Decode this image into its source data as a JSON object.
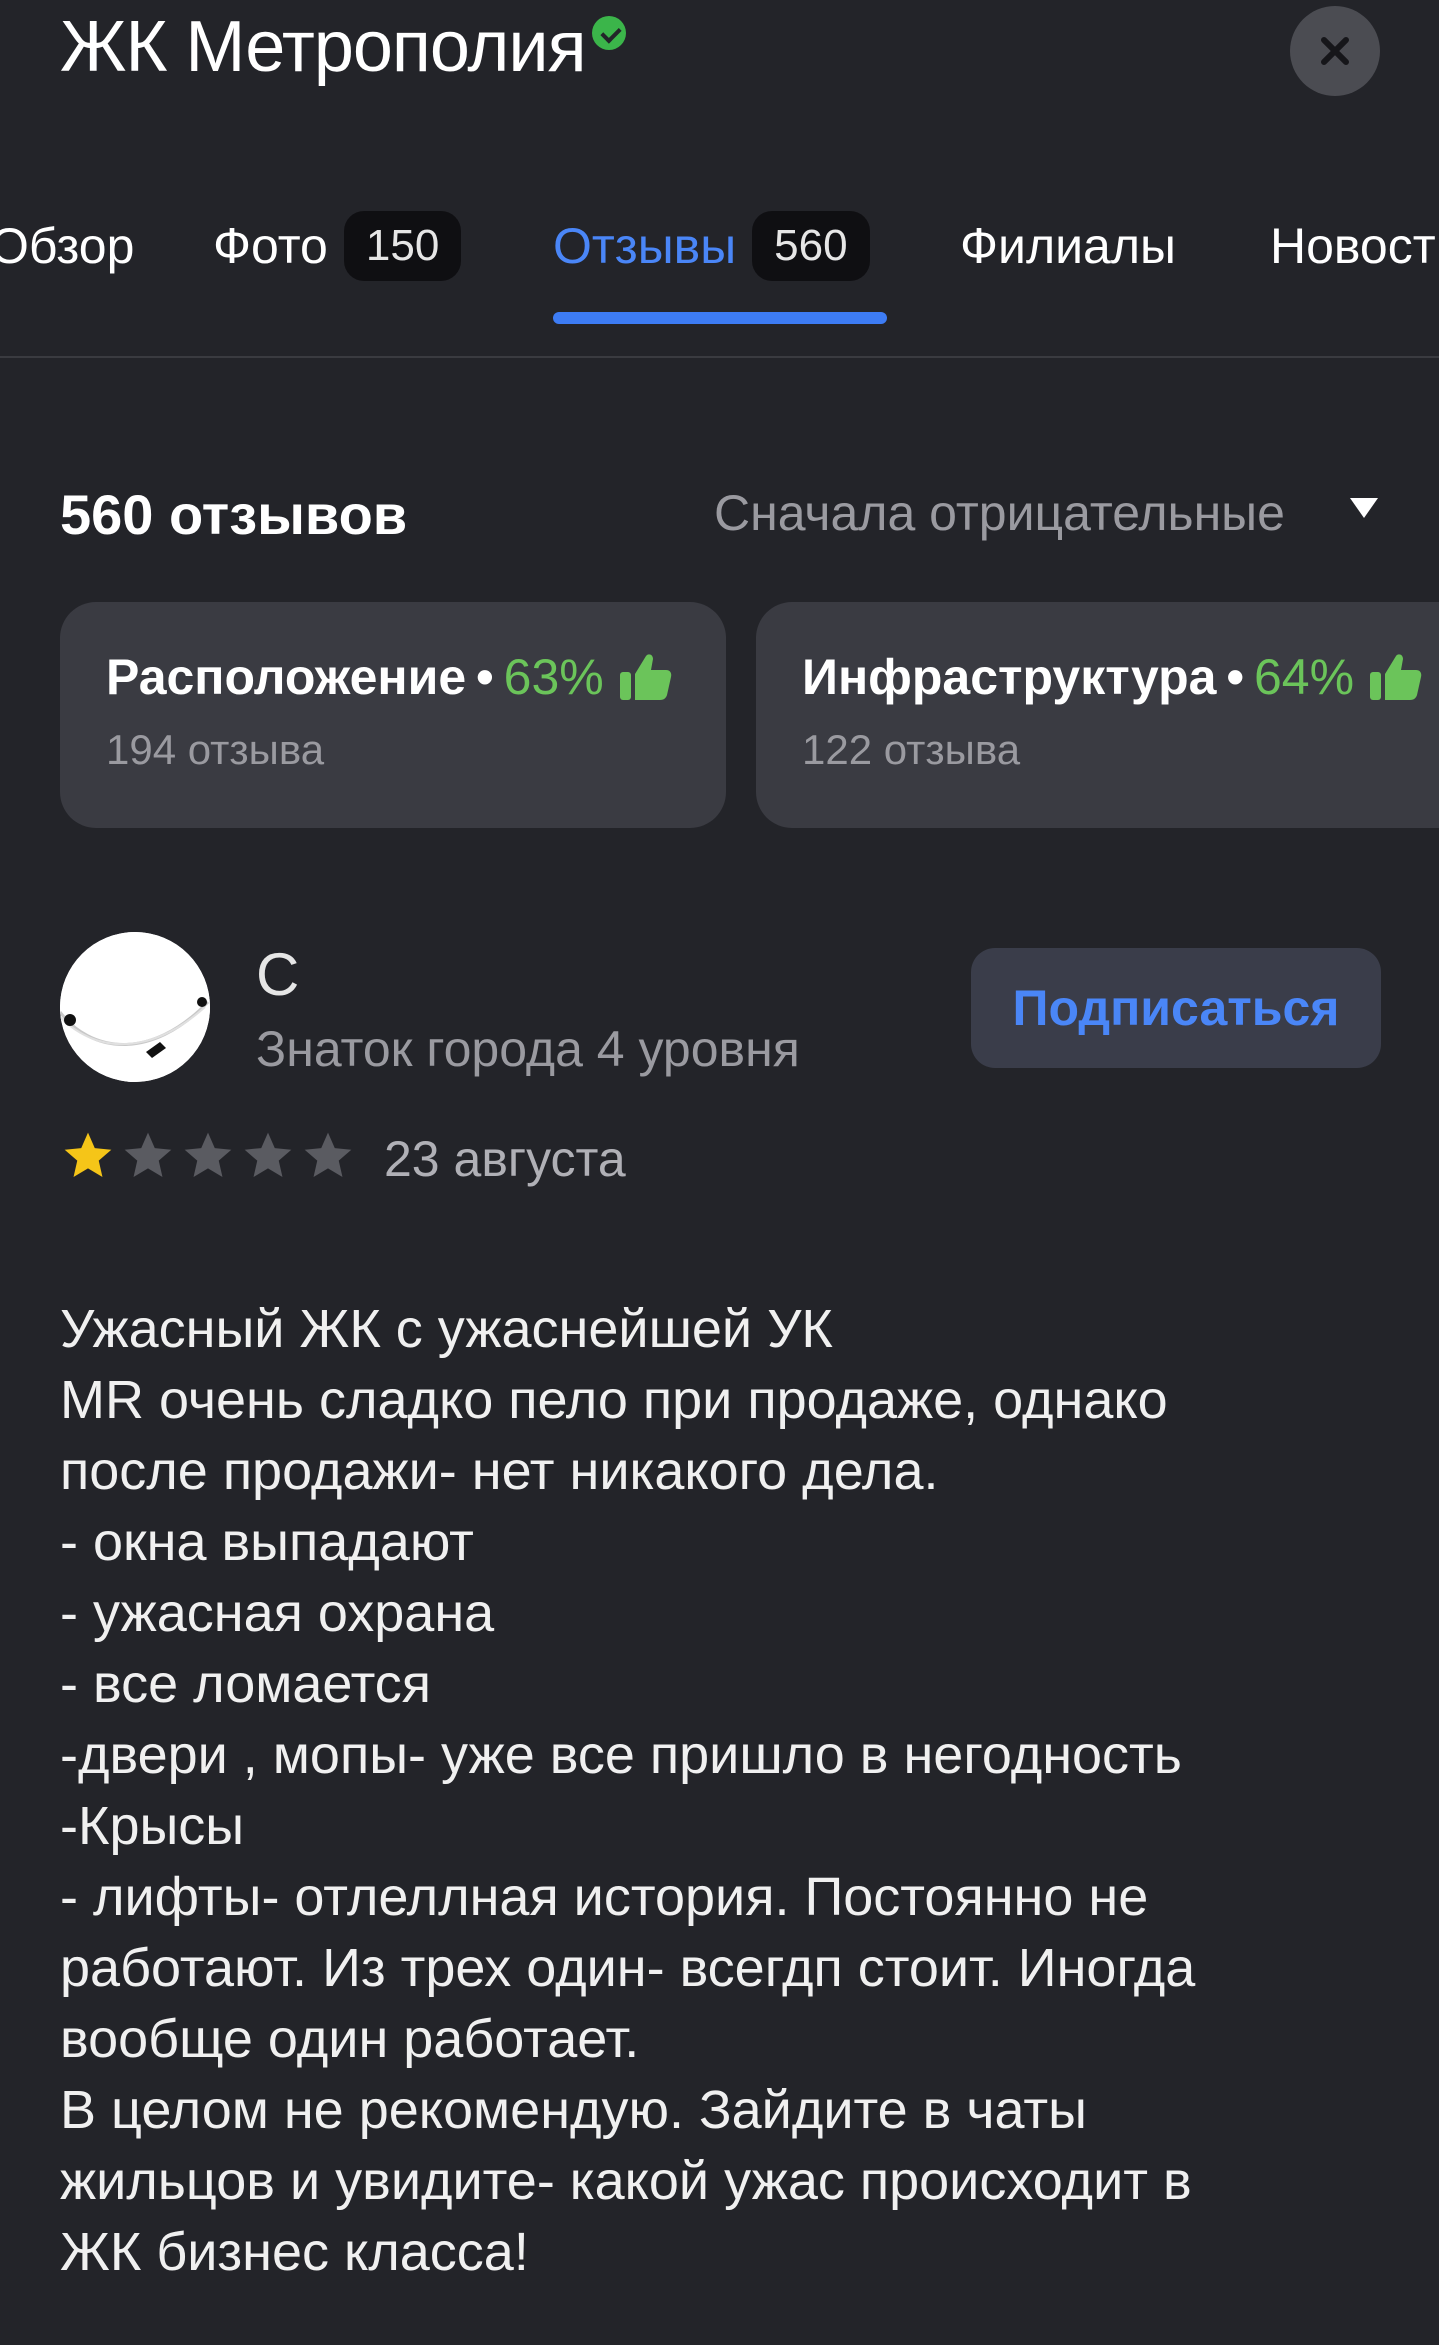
{
  "header": {
    "title": "ЖК Метрополия",
    "verified_icon": "verified-badge-icon",
    "close_icon": "close-icon"
  },
  "tabs": [
    {
      "label": "Обзор",
      "badge": null,
      "active": false
    },
    {
      "label": "Фото",
      "badge": "150",
      "active": false
    },
    {
      "label": "Отзывы",
      "badge": "560",
      "active": true
    },
    {
      "label": "Филиалы",
      "badge": null,
      "active": false
    },
    {
      "label": "Новост",
      "badge": null,
      "active": false
    }
  ],
  "reviews_header": {
    "count_label": "560 отзывов",
    "sort_label": "Сначала отрицательные"
  },
  "aspects": [
    {
      "name": "Расположение",
      "percent": "63%",
      "reviews": "194 отзыва"
    },
    {
      "name": "Инфраструктура",
      "percent": "64%",
      "reviews": "122 отзыва"
    }
  ],
  "review": {
    "author": "С",
    "level": "Знаток города 4 уровня",
    "subscribe_label": "Подписаться",
    "rating": 1,
    "rating_max": 5,
    "date": "23 августа",
    "text_lines": [
      "Ужасный ЖК с ужаснейшей УК",
      "MR очень сладко пело при продаже, однако",
      "после продажи- нет никакого дела.",
      "- окна выпадают",
      "- ужасная охрана",
      "- все ломается",
      "-двери , мопы- уже все пришло в негодность",
      "-Крысы",
      "- лифты- отлеллная история. Постоянно не",
      "работают. Из трех один- всегдп стоит. Иногда",
      "вообще один работает.",
      "В целом не рекомендую. Зайдите в чаты",
      "жильцов и увидите- какой ужас происходит в",
      "ЖК бизнес класса!"
    ]
  },
  "colors": {
    "background": "#232429",
    "accent_blue": "#3d7cf4",
    "positive_green": "#6bc45a",
    "star_filled": "#f5c518",
    "star_empty": "#5a5b61"
  }
}
